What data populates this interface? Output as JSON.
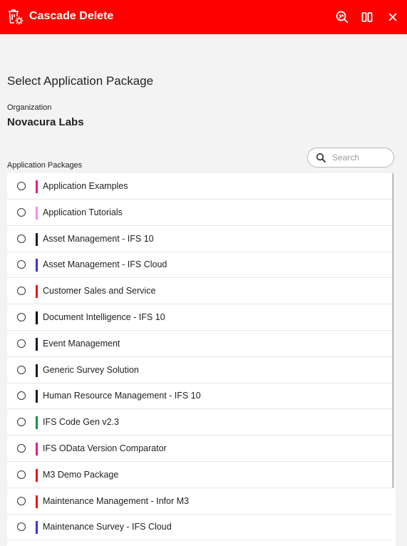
{
  "window": {
    "title": "Cascade Delete",
    "colors": {
      "titlebar": "#ff0000",
      "background": "#f3f3f3"
    }
  },
  "heading": "Select Application Package",
  "organization": {
    "label": "Organization",
    "value": "Novacura Labs"
  },
  "packages": {
    "label": "Application Packages",
    "search_placeholder": "Search",
    "items": [
      {
        "label": "Application Examples",
        "color": "#e6198a",
        "selected": false
      },
      {
        "label": "Application Tutorials",
        "color": "#f28ce8",
        "selected": false
      },
      {
        "label": "Asset Management - IFS 10",
        "color": "#111827",
        "selected": false
      },
      {
        "label": "Asset Management - IFS Cloud",
        "color": "#3b30e0",
        "selected": false
      },
      {
        "label": "Customer Sales and Service",
        "color": "#ee1111",
        "selected": false
      },
      {
        "label": "Document Intelligence - IFS 10",
        "color": "#000000",
        "selected": false
      },
      {
        "label": "Event Management",
        "color": "#111827",
        "selected": false
      },
      {
        "label": "Generic Survey Solution",
        "color": "#111827",
        "selected": false
      },
      {
        "label": "Human Resource Management - IFS 10",
        "color": "#111827",
        "selected": false
      },
      {
        "label": "IFS Code Gen v2.3",
        "color": "#12914a",
        "selected": false
      },
      {
        "label": "IFS OData Version Comparator",
        "color": "#e6198a",
        "selected": false
      },
      {
        "label": "M3 Demo Package",
        "color": "#ee1111",
        "selected": false
      },
      {
        "label": "Maintenance Management - Infor M3",
        "color": "#ee1111",
        "selected": false
      },
      {
        "label": "Maintenance Survey - IFS Cloud",
        "color": "#3b30e0",
        "selected": false
      }
    ]
  }
}
